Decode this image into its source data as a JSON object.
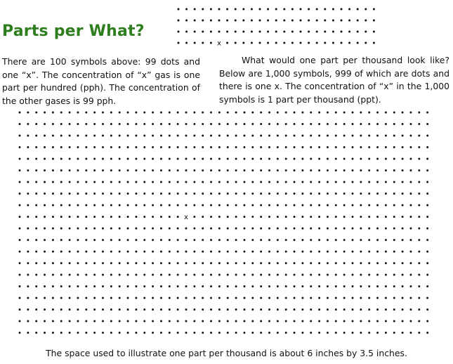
{
  "title": "Parts per What?",
  "paragraph_left": "There are 100 symbols above: 99 dots and one “x”.  The concentration of “x” gas is one part per hundred (pph).  The concentration of the other gases is 99 pph.",
  "paragraph_right": "What would one part per thousand look like?  Below are 1,000 symbols, 999 of which are dots and there is one x.  The concentration of “x” in the 1,000 symbols is 1 part per thousand (ppt).",
  "footer": "The space used to illustrate one part per thousand is about 6 inches by 3.5 inches.",
  "colors": {
    "title": "#2e7d1e",
    "text": "#111111",
    "dot": "#111111"
  },
  "grid_hundred": {
    "rows": 4,
    "cols": 25,
    "marker_row": 4,
    "marker_col": 6,
    "marker_symbol": "x"
  },
  "grid_thousand": {
    "rows": 20,
    "cols": 50,
    "marker_row": 10,
    "marker_col": 21,
    "marker_symbol": "x"
  }
}
